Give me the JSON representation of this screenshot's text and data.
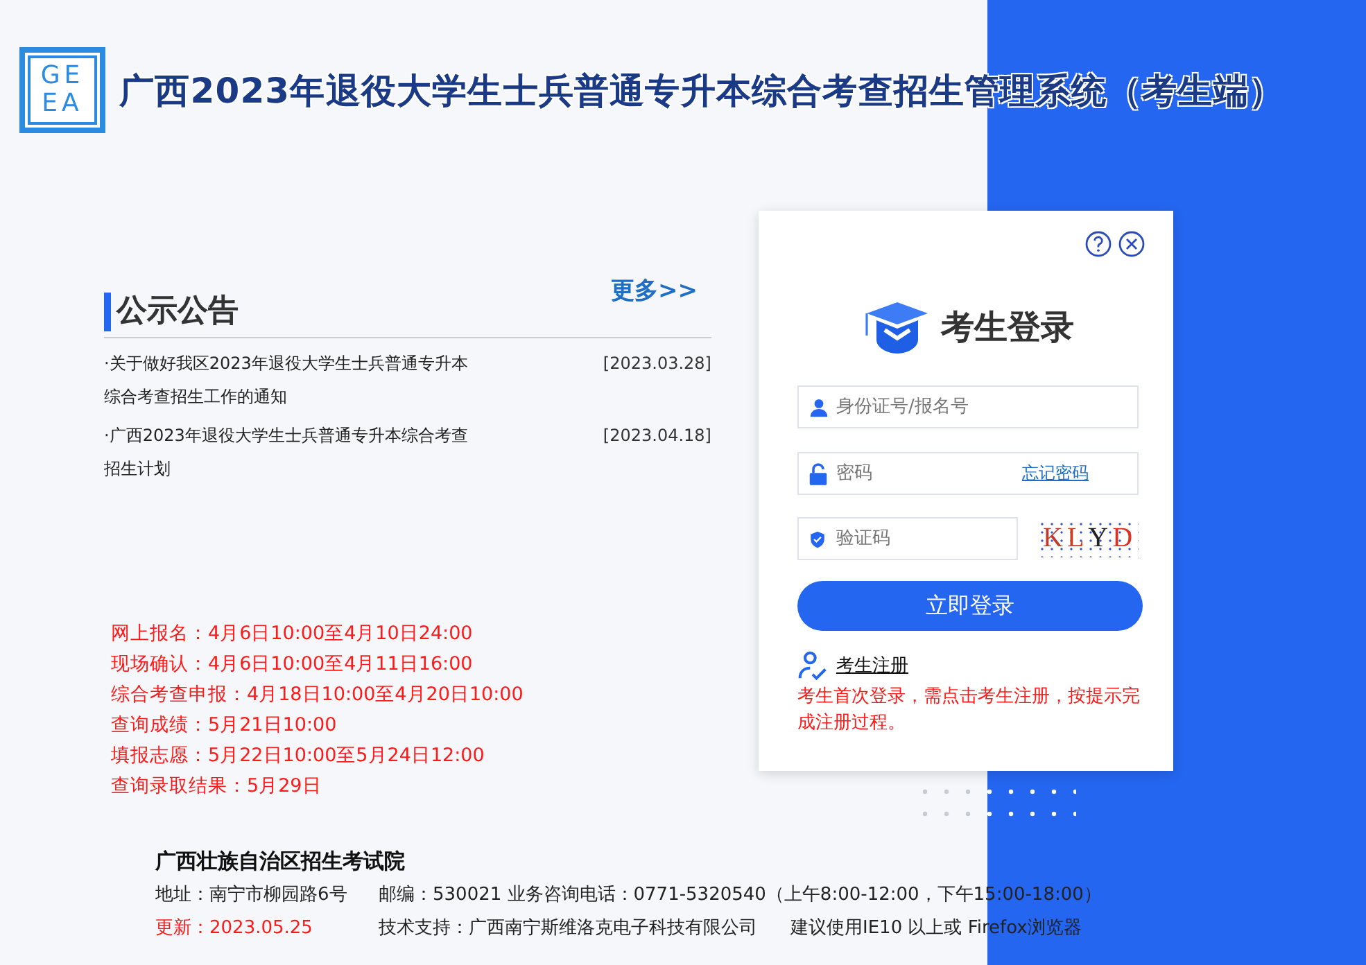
{
  "header": {
    "logo_text": [
      "GE",
      "EA"
    ],
    "title": "广西2023年退役大学生士兵普通专升本综合考查招生管理系统（考生端）"
  },
  "notices": {
    "title": "公示公告",
    "more": "更多>>",
    "items": [
      {
        "title": "·关于做好我区2023年退役大学生士兵普通专升本综合考查招生工作的通知",
        "date": "[2023.03.28]"
      },
      {
        "title": "·广西2023年退役大学生士兵普通专升本综合考查招生计划",
        "date": "[2023.04.18]"
      }
    ]
  },
  "schedule": [
    "网上报名：4月6日10:00至4月10日24:00",
    "现场确认：4月6日10:00至4月11日16:00",
    "综合考查申报：4月18日10:00至4月20日10:00",
    "查询成绩：5月21日10:00",
    "填报志愿：5月22日10:00至5月24日12:00",
    "查询录取结果：5月29日"
  ],
  "login": {
    "title": "考生登录",
    "username_placeholder": "身份证号/报名号",
    "password_placeholder": "密码",
    "forgot": "忘记密码",
    "captcha_placeholder": "验证码",
    "captcha": "KLYD",
    "submit": "立即登录",
    "register": "考生注册",
    "note": "考生首次登录，需点击考生注册，按提示完成注册过程。"
  },
  "footer": {
    "org": "广西壮族自治区招生考试院",
    "address": "地址：南宁市柳园路6号",
    "contact": "邮编：530021 业务咨询电话：0771-5320540（上午8:00-12:00，下午15:00-18:00）",
    "updated": "更新：2023.05.25",
    "support": "技术支持：广西南宁斯维洛克电子科技有限公司",
    "browser": "建议使用IE10 以上或 Firefox浏览器"
  }
}
